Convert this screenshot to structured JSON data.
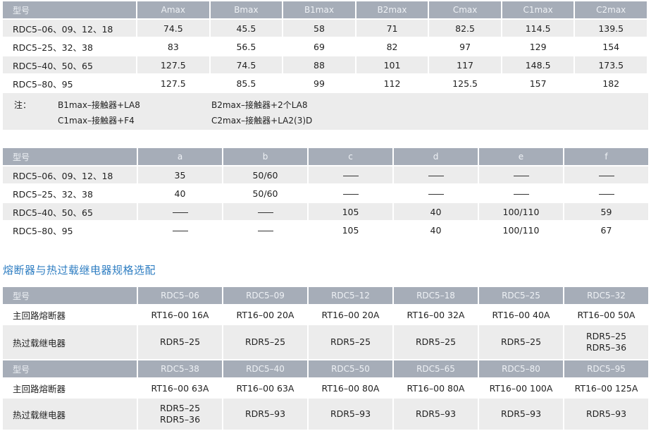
{
  "dim_table": {
    "headers": [
      "型号",
      "Amax",
      "Bmax",
      "B1max",
      "B2max",
      "Cmax",
      "C1max",
      "C2max"
    ],
    "rows": [
      [
        "RDC5–06、09、12、18",
        "74.5",
        "45.5",
        "58",
        "71",
        "82.5",
        "114.5",
        "139.5"
      ],
      [
        "RDC5–25、32、38",
        "83",
        "56.5",
        "69",
        "82",
        "97",
        "129",
        "154"
      ],
      [
        "RDC5–40、50、65",
        "127.5",
        "74.5",
        "88",
        "101",
        "117",
        "148.5",
        "173.5"
      ],
      [
        "RDC5–80、95",
        "127.5",
        "85.5",
        "99",
        "112",
        "125.5",
        "157",
        "182"
      ]
    ],
    "notes": {
      "label": "注：",
      "items": [
        "B1max–接触器+LA8",
        "B2max–接触器+2个LA8",
        "C1max–接触器+F4",
        "C2max–接触器+LA2(3)D"
      ]
    }
  },
  "mount_table": {
    "headers": [
      "型号",
      "a",
      "b",
      "c",
      "d",
      "e",
      "f"
    ],
    "rows": [
      [
        "RDC5–06、09、12、18",
        "35",
        "50/60",
        "—",
        "—",
        "—",
        "—"
      ],
      [
        "RDC5–25、32、38",
        "40",
        "50/60",
        "—",
        "—",
        "—",
        "—"
      ],
      [
        "RDC5–40、50、65",
        "—",
        "—",
        "105",
        "40",
        "100/110",
        "59"
      ],
      [
        "RDC5–80、95",
        "—",
        "—",
        "105",
        "40",
        "100/110",
        "67"
      ]
    ]
  },
  "section_title": "熔断器与热过载继电器规格选配",
  "fuse_table": {
    "blocks": [
      {
        "headers": [
          "型号",
          "RDC5–06",
          "RDC5–09",
          "RDC5–12",
          "RDC5–18",
          "RDC5–25",
          "RDC5–32"
        ],
        "fuse_label": "主回路熔断器",
        "fuses": [
          "RT16–00 16A",
          "RT16–00 20A",
          "RT16–00 20A",
          "RT16–00 32A",
          "RT16–00 40A",
          "RT16–00 50A"
        ],
        "relay_label": "热过载继电器",
        "relays": [
          [
            "RDR5–25"
          ],
          [
            "RDR5–25"
          ],
          [
            "RDR5–25"
          ],
          [
            "RDR5–25"
          ],
          [
            "RDR5–25"
          ],
          [
            "RDR5–25",
            "RDR5–36"
          ]
        ]
      },
      {
        "headers": [
          "型号",
          "RDC5–38",
          "RDC5–40",
          "RDC5–50",
          "RDC5–65",
          "RDC5–80",
          "RDC5–95"
        ],
        "fuse_label": "主回路熔断器",
        "fuses": [
          "RT16–00 63A",
          "RT16–00 63A",
          "RT16–00 80A",
          "RT16–00 80A",
          "RT16–00 100A",
          "RT16–00 125A"
        ],
        "relay_label": "热过载继电器",
        "relays": [
          [
            "RDR5–25",
            "RDR5–36"
          ],
          [
            "RDR5–93"
          ],
          [
            "RDR5–93"
          ],
          [
            "RDR5–93"
          ],
          [
            "RDR5–93"
          ],
          [
            "RDR5–93"
          ]
        ]
      }
    ]
  }
}
